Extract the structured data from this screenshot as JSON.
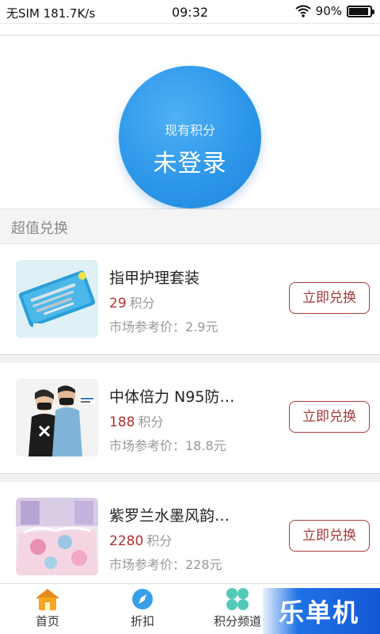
{
  "status_bar": {
    "carrier": "无SIM 181.7K/s",
    "time": "09:32",
    "battery": "90%"
  },
  "header": {
    "points_label": "现有积分",
    "points_value": "未登录"
  },
  "section": {
    "title": "超值兑换"
  },
  "products": [
    {
      "title": "指甲护理套装",
      "points": "29",
      "unit": "积分",
      "market_price": "市场参考价：2.9元",
      "button": "立即兑换"
    },
    {
      "title": "中体倍力 N95防…",
      "points": "188",
      "unit": "积分",
      "market_price": "市场参考价：18.8元",
      "button": "立即兑换"
    },
    {
      "title": "紫罗兰水墨风韵…",
      "points": "2280",
      "unit": "积分",
      "market_price": "市场参考价：228元",
      "button": "立即兑换"
    }
  ],
  "nav": {
    "home": "首页",
    "discount": "折扣",
    "points_channel": "积分频道"
  },
  "watermark": "乐单机",
  "colors": {
    "accent_blue": "#2d97ea",
    "points_red": "#b42f2f",
    "button_red": "#a83a3a"
  }
}
